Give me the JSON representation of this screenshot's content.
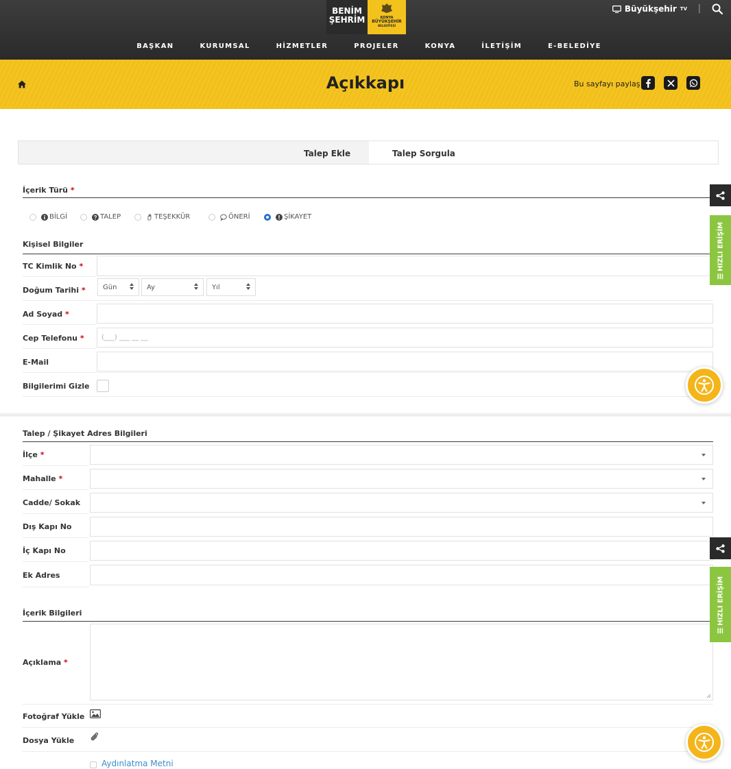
{
  "header": {
    "logo_line1": "BENİM",
    "logo_line2": "ŞEHRİM",
    "logo_b1": "KONYA",
    "logo_b2": "BÜYÜKŞEHİR",
    "logo_b3": "BELEDİYESİ",
    "tv_label": "Büyükşehir",
    "tv_suffix": "TV",
    "separator": "|",
    "menu": [
      "BAŞKAN",
      "KURUMSAL",
      "HİZMETLER",
      "PROJELER",
      "KONYA",
      "İLETİŞİM",
      "E-BELEDİYE"
    ]
  },
  "banner": {
    "title": "Açıkkapı",
    "share_text": "Bu sayfayı paylaş"
  },
  "tabs": {
    "add": "Talep Ekle",
    "query": "Talep Sorgula"
  },
  "form": {
    "content_type_label": "İçerik Türü",
    "required_mark": "*",
    "radios": [
      {
        "label": "BİLGİ",
        "selected": false
      },
      {
        "label": "TALEP",
        "selected": false
      },
      {
        "label": "TEŞEKKÜR",
        "selected": false
      },
      {
        "label": "ÖNERİ",
        "selected": false
      },
      {
        "label": "ŞİKAYET",
        "selected": true
      }
    ],
    "personal_title": "Kişisel Bilgiler",
    "tc_label": "TC Kimlik No",
    "dob_label": "Doğum Tarihi",
    "dob_day": "Gün",
    "dob_month": "Ay",
    "dob_year": "Yıl",
    "name_label": "Ad Soyad",
    "phone_label": "Cep Telefonu",
    "phone_mask": "(___) ___ __ __",
    "email_label": "E-Mail",
    "hide_label": "Bilgilerimi Gizle",
    "address_title": "Talep / Şikayet Adres Bilgileri",
    "district_label": "İlçe",
    "neighborhood_label": "Mahalle",
    "street_label": "Cadde/ Sokak",
    "outer_door_label": "Dış Kapı No",
    "inner_door_label": "İç Kapı No",
    "extra_address_label": "Ek Adres",
    "content_title": "İçerik Bilgileri",
    "description_label": "Açıklama",
    "photo_label": "Fotoğraf Yükle",
    "file_label": "Dosya Yükle",
    "consent_link": "Aydınlatma Metni"
  },
  "widgets": {
    "quick_access": "HIZLI ERİŞİM"
  }
}
